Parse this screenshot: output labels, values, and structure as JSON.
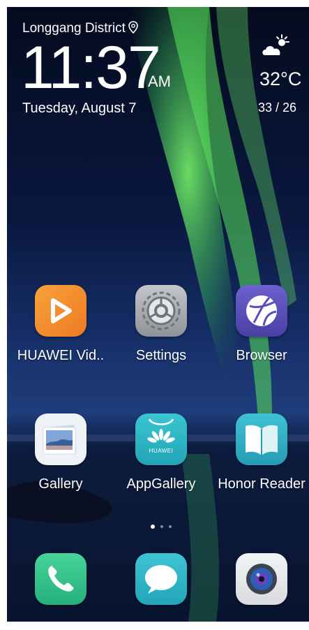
{
  "status": {
    "location": "Longgang District",
    "time": "11:37",
    "ampm": "AM",
    "date": "Tuesday, August 7",
    "temperature": "32°C",
    "temp_range": "33 / 26",
    "weather_icon": "partly-cloudy-icon"
  },
  "apps": [
    {
      "label": "HUAWEI Vid..",
      "icon": "huawei-video-icon",
      "color": "#f08a2c"
    },
    {
      "label": "Settings",
      "icon": "settings-gear-icon",
      "color": "#9ea3a8"
    },
    {
      "label": "Browser",
      "icon": "browser-globe-icon",
      "color": "#5a4fb8"
    },
    {
      "label": "Gallery",
      "icon": "gallery-icon",
      "color": "#eef1f6"
    },
    {
      "label": "AppGallery",
      "icon": "appgallery-icon",
      "color": "#2fb8c5"
    },
    {
      "label": "Honor Reader",
      "icon": "reader-book-icon",
      "color": "#34b3c7"
    }
  ],
  "pages": {
    "count": 3,
    "active": 1
  },
  "dock": [
    {
      "icon": "phone-icon",
      "color": "#35c48d"
    },
    {
      "icon": "messages-icon",
      "color": "#33b6c8"
    },
    {
      "icon": "camera-icon",
      "color": "#e8e9ec"
    }
  ]
}
